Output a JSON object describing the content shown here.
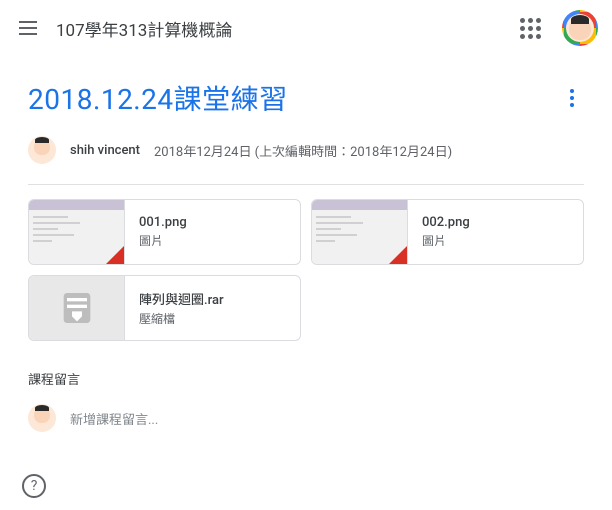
{
  "topbar": {
    "course_title": "107學年313計算機概論"
  },
  "post": {
    "title": "2018.12.24課堂練習",
    "author": "shih vincent",
    "dates": "2018年12月24日 (上次編輯時間：2018年12月24日)"
  },
  "attachments": [
    {
      "name": "001.png",
      "type": "圖片",
      "kind": "image"
    },
    {
      "name": "002.png",
      "type": "圖片",
      "kind": "image"
    },
    {
      "name": "陣列與迴圈.rar",
      "type": "壓縮檔",
      "kind": "archive"
    }
  ],
  "comments": {
    "section_label": "課程留言",
    "placeholder": "新增課程留言..."
  }
}
